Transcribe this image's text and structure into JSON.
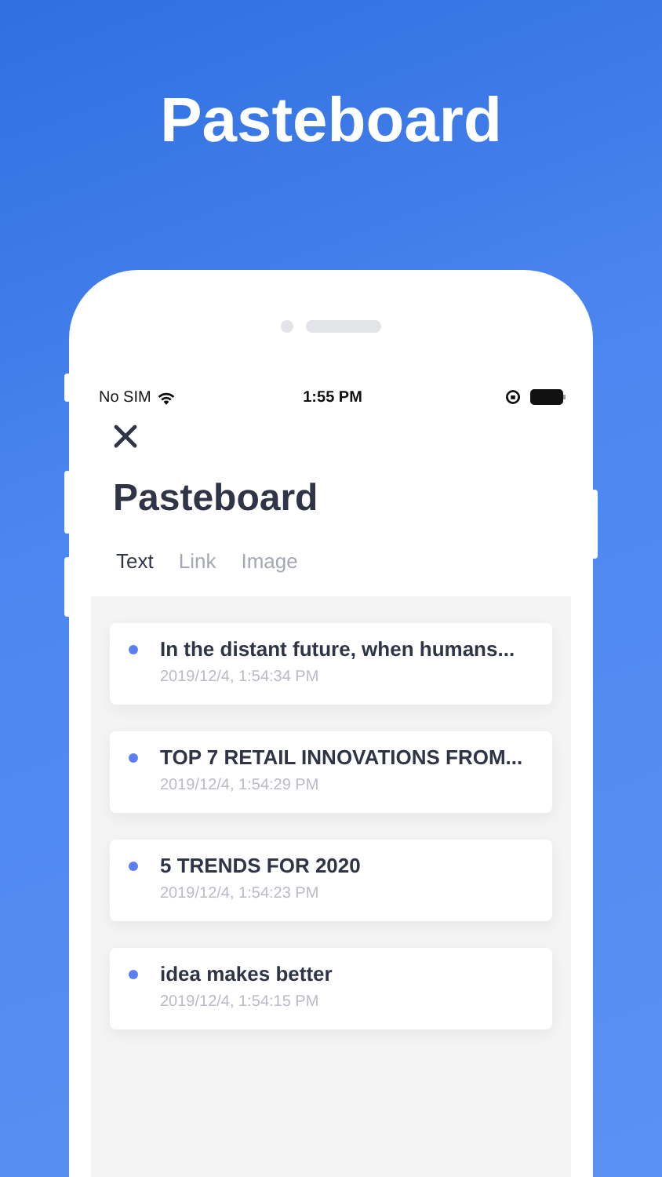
{
  "headline": "Pasteboard",
  "status_bar": {
    "carrier": "No SIM",
    "time": "1:55 PM"
  },
  "title": "Pasteboard",
  "tabs": [
    {
      "label": "Text",
      "selected": true
    },
    {
      "label": "Link",
      "selected": false
    },
    {
      "label": "Image",
      "selected": false
    }
  ],
  "clips": [
    {
      "text": "In the distant future, when humans...",
      "time": "2019/12/4, 1:54:34 PM"
    },
    {
      "text": "TOP 7 RETAIL INNOVATIONS FROM...",
      "time": "2019/12/4, 1:54:29 PM"
    },
    {
      "text": "5 TRENDS FOR 2020",
      "time": "2019/12/4, 1:54:23 PM"
    },
    {
      "text": "idea makes better",
      "time": "2019/12/4, 1:54:15 PM"
    }
  ]
}
